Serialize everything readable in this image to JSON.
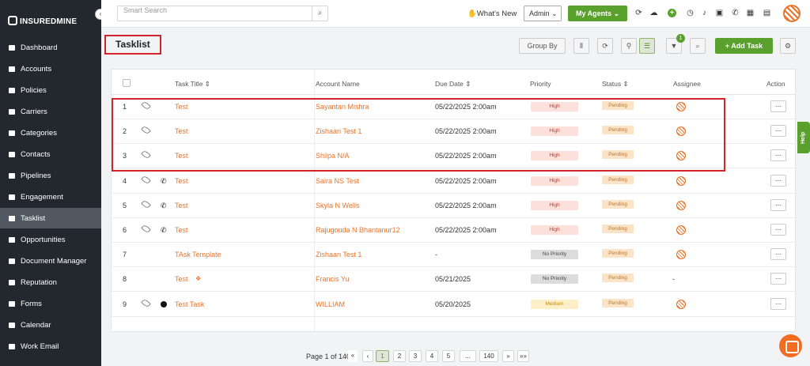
{
  "brand": {
    "logo_text": "INSUREDMINE",
    "accent": "#e8742a",
    "green": "#5aa02c",
    "highlight": "#d3232c"
  },
  "sidebar": {
    "collapse_icon": "chevron-left-icon",
    "items": [
      {
        "label": "Dashboard",
        "icon": "dashboard-icon"
      },
      {
        "label": "Accounts",
        "icon": "users-icon"
      },
      {
        "label": "Policies",
        "icon": "document-icon"
      },
      {
        "label": "Carriers",
        "icon": "briefcase-icon"
      },
      {
        "label": "Categories",
        "icon": "list-icon"
      },
      {
        "label": "Contacts",
        "icon": "contact-card-icon"
      },
      {
        "label": "Pipelines",
        "icon": "funnel-icon"
      },
      {
        "label": "Engagement",
        "icon": "megaphone-icon"
      },
      {
        "label": "Tasklist",
        "icon": "checklist-icon",
        "active": true
      },
      {
        "label": "Opportunities",
        "icon": "bar-chart-icon"
      },
      {
        "label": "Document Manager",
        "icon": "folder-icon"
      },
      {
        "label": "Reputation",
        "icon": "star-icon"
      },
      {
        "label": "Forms",
        "icon": "form-icon"
      },
      {
        "label": "Calendar",
        "icon": "calendar-icon"
      },
      {
        "label": "Work Email",
        "icon": "mail-icon"
      }
    ]
  },
  "topbar": {
    "search_placeholder": "Smart Search",
    "whats_new": "What's New",
    "role_select": "Admin",
    "my_agents": "My Agents"
  },
  "page": {
    "title": "Tasklist",
    "group_by": "Group By",
    "filter_count": "1",
    "add_task": "Add Task"
  },
  "table": {
    "columns": [
      "Task Title",
      "Account Name",
      "Due Date",
      "Priority",
      "Status",
      "Assignee",
      "Action"
    ],
    "rows": [
      {
        "no": "1",
        "eye": true,
        "call": false,
        "clock": false,
        "tag": false,
        "title": "Test",
        "account": "Sayantan Mishra",
        "due": "05/22/2025  2:00am",
        "priority": "High",
        "status": "Pending",
        "assignee": true
      },
      {
        "no": "2",
        "eye": true,
        "call": false,
        "clock": false,
        "tag": false,
        "title": "Test",
        "account": "Zishaan Test 1",
        "due": "05/22/2025  2:00am",
        "priority": "High",
        "status": "Pending",
        "assignee": true
      },
      {
        "no": "3",
        "eye": true,
        "call": false,
        "clock": false,
        "tag": false,
        "title": "Test",
        "account": "Shilpa N/A",
        "due": "05/22/2025  2:00am",
        "priority": "High",
        "status": "Pending",
        "assignee": true
      },
      {
        "no": "4",
        "eye": true,
        "call": true,
        "clock": false,
        "tag": false,
        "title": "Test",
        "account": "Saira NS Test",
        "due": "05/22/2025  2:00am",
        "priority": "High",
        "status": "Pending",
        "assignee": true
      },
      {
        "no": "5",
        "eye": true,
        "call": true,
        "clock": false,
        "tag": false,
        "title": "Test",
        "account": "Skyla N Wells",
        "due": "05/22/2025  2:00am",
        "priority": "High",
        "status": "Pending",
        "assignee": true
      },
      {
        "no": "6",
        "eye": true,
        "call": true,
        "clock": false,
        "tag": false,
        "title": "Test",
        "account": "Rajugouda N Bhantanur12",
        "due": "05/22/2025  2:00am",
        "priority": "High",
        "status": "Pending",
        "assignee": true
      },
      {
        "no": "7",
        "eye": false,
        "call": false,
        "clock": false,
        "tag": false,
        "title": "TAsk Template",
        "account": "Zishaan Test 1",
        "due": "-",
        "priority": "No Priority",
        "status": "Pending",
        "assignee": true
      },
      {
        "no": "8",
        "eye": false,
        "call": false,
        "clock": false,
        "tag": true,
        "title": "Test",
        "account": "Francis Yu",
        "due": "05/21/2025",
        "priority": "No Priority",
        "status": "Pending",
        "assignee": false,
        "assignee_text": "-"
      },
      {
        "no": "9",
        "eye": true,
        "call": false,
        "clock": true,
        "tag": false,
        "title": "Test Task",
        "account": "WILLIAM",
        "due": "05/20/2025",
        "priority": "Medium",
        "status": "Pending",
        "assignee": true
      }
    ],
    "action_label": "..."
  },
  "priority_colors": {
    "High": [
      "#fbe0dc",
      "#c0392b"
    ],
    "No Priority": [
      "#dcdcdc",
      "#444"
    ],
    "Medium": [
      "#fdf0c8",
      "#c98a00"
    ]
  },
  "pagination": {
    "info": "Page 1 of 140",
    "first": "«",
    "prev": "‹",
    "pages": [
      "1",
      "2",
      "3",
      "4",
      "5",
      "...",
      "140"
    ],
    "current": "1",
    "next": "»",
    "last": "»»"
  },
  "help_tab": "Help"
}
